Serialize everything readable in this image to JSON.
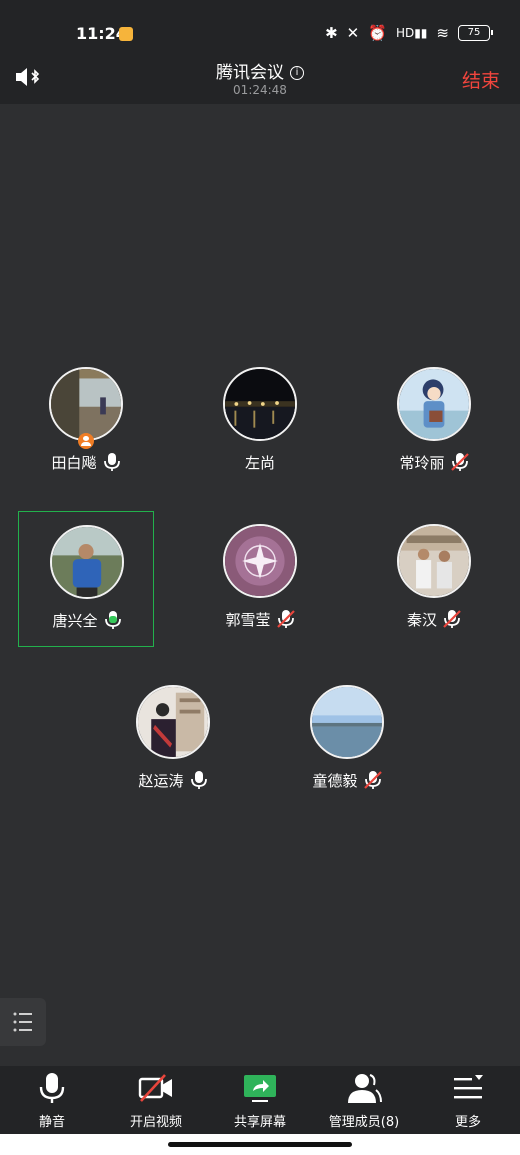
{
  "status_bar": {
    "time": "11:24",
    "battery": "75"
  },
  "header": {
    "title": "腾讯会议",
    "timer": "01:24:48",
    "end_label": "结束"
  },
  "participants": [
    {
      "name": "田白飚",
      "mic": "on",
      "is_host": true
    },
    {
      "name": "左尚",
      "mic": "none"
    },
    {
      "name": "常玲丽",
      "mic": "muted"
    },
    {
      "name": "唐兴全",
      "mic": "speaking",
      "active": true
    },
    {
      "name": "郭雪莹",
      "mic": "muted"
    },
    {
      "name": "秦汉",
      "mic": "muted"
    },
    {
      "name": "赵运涛",
      "mic": "on"
    },
    {
      "name": "童德毅",
      "mic": "muted"
    }
  ],
  "toolbar": {
    "mute_label": "静音",
    "video_label": "开启视频",
    "share_label": "共享屏幕",
    "members_label": "管理成员(8)",
    "more_label": "更多"
  },
  "colors": {
    "end": "#f2453d",
    "active_border": "#22b14c",
    "share_icon": "#2fb35a",
    "host_badge": "#f07d25",
    "muted_slash": "#e8453c"
  }
}
